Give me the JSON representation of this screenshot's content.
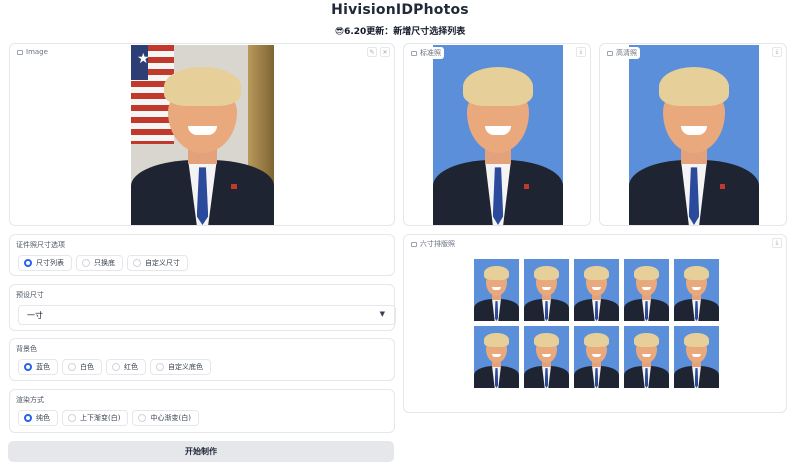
{
  "app": {
    "title": "HivisionIDPhotos",
    "subtitle": "😎6.20更新：新增尺寸选择列表"
  },
  "image_panel": {
    "label": "Image",
    "icons": [
      "edit-icon",
      "close-icon"
    ]
  },
  "standard_panel": {
    "label": "标准照",
    "icons": [
      "download-icon"
    ]
  },
  "hd_panel": {
    "label": "高清照",
    "icons": [
      "download-icon"
    ]
  },
  "layout_panel": {
    "label": "六寸排版照",
    "icons": [
      "download-icon"
    ]
  },
  "size_options": {
    "label": "证件照尺寸选项",
    "options": [
      "尺寸列表",
      "只换底",
      "自定义尺寸"
    ],
    "selected": "尺寸列表"
  },
  "preset_size": {
    "label": "预设尺寸",
    "value": "一寸"
  },
  "background_color": {
    "label": "背景色",
    "options": [
      "蓝色",
      "白色",
      "红色",
      "自定义底色"
    ],
    "selected": "蓝色"
  },
  "render_mode": {
    "label": "渲染方式",
    "options": [
      "纯色",
      "上下渐变(白)",
      "中心渐变(白)"
    ],
    "selected": "纯色"
  },
  "actions": {
    "start_label": "开始制作"
  },
  "colors": {
    "accent": "#2563eb",
    "photo_bg_blue": "#5b8fd9",
    "suit": "#1e2431"
  }
}
